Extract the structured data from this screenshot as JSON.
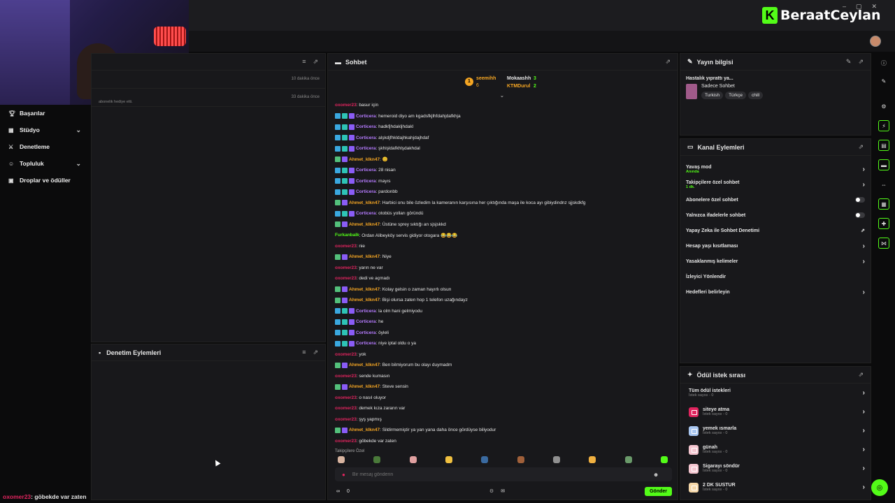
{
  "brand": {
    "name": "BeraatCeylan",
    "logo_letter": "K",
    "accent": "#53fc18"
  },
  "nav": {
    "items": [
      {
        "label": "Başarılar",
        "icon": "trophy-icon",
        "expandable": false
      },
      {
        "label": "Stüdyo",
        "icon": "studio-icon",
        "expandable": true
      },
      {
        "label": "Denetleme",
        "icon": "sword-icon",
        "expandable": false
      },
      {
        "label": "Topluluk",
        "icon": "community-icon",
        "expandable": true
      },
      {
        "label": "Droplar ve ödüller",
        "icon": "gift-icon",
        "expandable": false
      }
    ]
  },
  "activity": {
    "rows": [
      {
        "time": "10 dakika önce",
        "text": ""
      },
      {
        "time": "33 dakika önce",
        "text": "abonelik hediye etti."
      }
    ]
  },
  "moderation": {
    "title": "Denetim Eylemleri"
  },
  "chat": {
    "title": "Sohbet",
    "leaderboard": [
      {
        "rank": "1",
        "name": "seemihh",
        "value": "6",
        "color": "#f5a623"
      },
      {
        "name": "Mokaashh",
        "value": "3",
        "color": "#e6e6e6"
      },
      {
        "name": "KTMDurul",
        "value": "2",
        "color": "#f5a623"
      }
    ],
    "messages": [
      {
        "user": "oxomer23",
        "color": "#e0245e",
        "text": ": basur için",
        "badges": []
      },
      {
        "user": "Corticera",
        "color": "#b67cff",
        "text": ": hemeroid diyo am kgadsfkjlhfdahjdafkhja",
        "badges": [
          "#3aa8e0",
          "#2ec4b6",
          "#8a5cf6"
        ]
      },
      {
        "user": "Corticera",
        "color": "#b67cff",
        "text": ": hadkfjhdakljhdakl",
        "badges": [
          "#3aa8e0",
          "#2ec4b6",
          "#8a5cf6"
        ]
      },
      {
        "user": "Corticera",
        "color": "#b67cff",
        "text": ": alşkdjfhkldajhkahjdajhdaf",
        "badges": [
          "#3aa8e0",
          "#2ec4b6",
          "#8a5cf6"
        ]
      },
      {
        "user": "Corticera",
        "color": "#b67cff",
        "text": ": şkhişldafkhlşdakhdal",
        "badges": [
          "#3aa8e0",
          "#2ec4b6",
          "#8a5cf6"
        ]
      },
      {
        "user": "Ahmet_klkn47",
        "color": "#f5a623",
        "text": ": 😊",
        "badges": [
          "#53c07b",
          "#8a5cf6"
        ]
      },
      {
        "user": "Corticera",
        "color": "#b67cff",
        "text": ": 28 nisan",
        "badges": [
          "#3aa8e0",
          "#2ec4b6",
          "#8a5cf6"
        ]
      },
      {
        "user": "Corticera",
        "color": "#b67cff",
        "text": ": mayıs",
        "badges": [
          "#3aa8e0",
          "#2ec4b6",
          "#8a5cf6"
        ]
      },
      {
        "user": "Corticera",
        "color": "#b67cff",
        "text": ": pardonbb",
        "badges": [
          "#3aa8e0",
          "#2ec4b6",
          "#8a5cf6"
        ]
      },
      {
        "user": "Ahmet_klkn47",
        "color": "#f5a623",
        "text": ": Harbici onu bile özledim la kameranın karşısına her çıktığında maşa ile koca ayı gibiydindnz sjjskdkfg",
        "badges": [
          "#53c07b",
          "#8a5cf6"
        ]
      },
      {
        "user": "Corticera",
        "color": "#b67cff",
        "text": ": otobüs yolları göründü",
        "badges": [
          "#3aa8e0",
          "#2ec4b6",
          "#8a5cf6"
        ]
      },
      {
        "user": "Ahmet_klkn47",
        "color": "#f5a623",
        "text": ": Üstüne sprey sıktığı an sjsjskkd",
        "badges": [
          "#53c07b",
          "#8a5cf6"
        ]
      },
      {
        "user": "Furkanbalk",
        "color": "#53fc18",
        "text": ": Ordan Alibeyköy servis gidiyor otogara 😂😂😂",
        "badges": []
      },
      {
        "user": "oxomer23",
        "color": "#e0245e",
        "text": ": nie",
        "badges": []
      },
      {
        "user": "Ahmet_klkn47",
        "color": "#f5a623",
        "text": ": Niye",
        "badges": [
          "#53c07b",
          "#8a5cf6"
        ]
      },
      {
        "user": "oxomer23",
        "color": "#e0245e",
        "text": ": yarın ne var",
        "badges": []
      },
      {
        "user": "oxomer23",
        "color": "#e0245e",
        "text": ": dedi ve açmadı",
        "badges": []
      },
      {
        "user": "Ahmet_klkn47",
        "color": "#f5a623",
        "text": ": Kolay gelsin o zaman hayırlı olsun",
        "badges": [
          "#53c07b",
          "#8a5cf6"
        ]
      },
      {
        "user": "Ahmet_klkn47",
        "color": "#f5a623",
        "text": ": Bişi olursa zaten hop 1 telefon uzağındayz",
        "badges": [
          "#53c07b",
          "#8a5cf6"
        ]
      },
      {
        "user": "Corticera",
        "color": "#b67cff",
        "text": ": la olm hani gelmiyodu",
        "badges": [
          "#3aa8e0",
          "#2ec4b6",
          "#8a5cf6"
        ]
      },
      {
        "user": "Corticera",
        "color": "#b67cff",
        "text": ": he",
        "badges": [
          "#3aa8e0",
          "#2ec4b6",
          "#8a5cf6"
        ]
      },
      {
        "user": "Corticera",
        "color": "#b67cff",
        "text": ": öyleli",
        "badges": [
          "#3aa8e0",
          "#2ec4b6",
          "#8a5cf6"
        ]
      },
      {
        "user": "Corticera",
        "color": "#b67cff",
        "text": ": niye iptal oldu o ya",
        "badges": [
          "#3aa8e0",
          "#2ec4b6",
          "#8a5cf6"
        ]
      },
      {
        "user": "oxomer23",
        "color": "#e0245e",
        "text": ": yok",
        "badges": []
      },
      {
        "user": "Ahmet_klkn47",
        "color": "#f5a623",
        "text": ": Ben bilmiyorum bu olayı duymadm",
        "badges": [
          "#53c07b",
          "#8a5cf6"
        ]
      },
      {
        "user": "oxomer23",
        "color": "#e0245e",
        "text": ": sende kumasın",
        "badges": []
      },
      {
        "user": "Ahmet_klkn47",
        "color": "#f5a623",
        "text": ": Steve sensin",
        "badges": [
          "#53c07b",
          "#8a5cf6"
        ]
      },
      {
        "user": "oxomer23",
        "color": "#e0245e",
        "text": ": o nasıl oluyor",
        "badges": []
      },
      {
        "user": "oxomer23",
        "color": "#e0245e",
        "text": ": demek kıza zararın var",
        "badges": []
      },
      {
        "user": "oxomer23",
        "color": "#e0245e",
        "text": ": şyş yapmış",
        "badges": []
      },
      {
        "user": "Ahmet_klkn47",
        "color": "#f5a623",
        "text": ": Sildirmemiştir ya yan yana daha önce gördüyse biliyodur",
        "badges": [
          "#53c07b",
          "#8a5cf6"
        ]
      },
      {
        "user": "oxomer23",
        "color": "#e0245e",
        "text": ": göbekde var zaten",
        "badges": []
      }
    ],
    "followers_only_label": "Takipçilere Özel",
    "input_placeholder": "Bir mesaj gönderin",
    "footer": {
      "infinity": "∞",
      "count": "0",
      "send_label": "Gönder"
    }
  },
  "stream_info": {
    "title": "Yayın bilgisi",
    "stream_title": "Hastalık yıprattı ya...",
    "category": "Sadece Sohbet",
    "tags": [
      "Turkish",
      "Türkçe",
      "chill"
    ]
  },
  "channel_actions": {
    "title": "Kanal Eylemleri",
    "items": [
      {
        "label": "Yavaş mod",
        "sub": "Anında",
        "control": "chevron"
      },
      {
        "label": "Takipçilere özel sohbet",
        "sub": "1 dk.",
        "control": "chevron"
      },
      {
        "label": "Abonelere özel sohbet",
        "sub": "",
        "control": "toggle"
      },
      {
        "label": "Yalnızca ifadelerle sohbet",
        "sub": "",
        "control": "toggle"
      },
      {
        "label": "Yapay Zeka ile Sohbet Denetimi",
        "sub": "",
        "control": "external"
      },
      {
        "label": "Hesap yaşı kısıtlaması",
        "sub": "",
        "control": "chevron"
      },
      {
        "label": "Yasaklanmış kelimeler",
        "sub": "",
        "control": "chevron"
      },
      {
        "label": "İzleyici Yönlendir",
        "sub": "",
        "control": "none"
      },
      {
        "label": "Hedefleri belirleyin",
        "sub": "",
        "control": "chevron"
      }
    ]
  },
  "rewards": {
    "title": "Ödül istek sırası",
    "all_label": "Tüm ödül istekleri",
    "all_sub": "İstek sayısı - 0",
    "items": [
      {
        "label": "siteye atma",
        "sub": "İstek sayısı - 0",
        "color": "#e0245e"
      },
      {
        "label": "yemek ısmarla",
        "sub": "İstek sayısı - 0",
        "color": "#a8c6f0"
      },
      {
        "label": "günah",
        "sub": "İstek sayısı - 0",
        "color": "#f5c6d0"
      },
      {
        "label": "Sigarayı söndür",
        "sub": "İstek sayısı - 0",
        "color": "#f5c6d0"
      },
      {
        "label": "2 DK SUSTUR",
        "sub": "İstek sayısı - 0",
        "color": "#f5d7a8"
      }
    ]
  },
  "ticker": {
    "user": "oxomer23",
    "text": ": göbekde var zaten"
  }
}
